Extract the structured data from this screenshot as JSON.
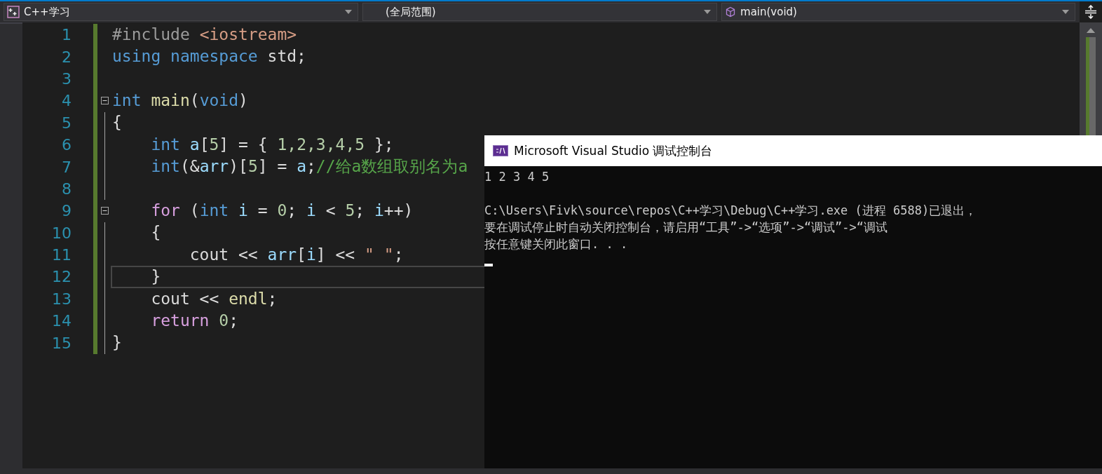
{
  "navigation_bar": {
    "dropdowns": [
      {
        "kind": "project",
        "label": "C++学习"
      },
      {
        "kind": "scope",
        "label": "(全局范围)"
      },
      {
        "kind": "member",
        "label": "main(void)"
      }
    ]
  },
  "editor": {
    "lines": [
      {
        "number": "1",
        "modified": true,
        "foldable": false,
        "current": false,
        "tokens": [
          {
            "text": "#include",
            "kind": "preprocessor"
          },
          {
            "text": " <iostream>",
            "kind": "string"
          }
        ]
      },
      {
        "number": "2",
        "modified": true,
        "foldable": false,
        "current": false,
        "tokens": [
          {
            "text": "using",
            "kind": "keyword"
          },
          {
            "text": " namespace",
            "kind": "keyword"
          },
          {
            "text": " std;",
            "kind": "plain"
          }
        ]
      },
      {
        "number": "3",
        "modified": true,
        "foldable": false,
        "current": false
      },
      {
        "number": "4",
        "modified": true,
        "foldable": true,
        "current": false,
        "tokens": [
          {
            "text": "int",
            "kind": "keyword"
          },
          {
            "text": " main",
            "kind": "function"
          },
          {
            "text": "(",
            "kind": "plain"
          },
          {
            "text": "void",
            "kind": "keyword"
          },
          {
            "text": ")",
            "kind": "plain"
          }
        ]
      },
      {
        "number": "5",
        "modified": true,
        "foldable": false,
        "current": false,
        "tokens": [
          {
            "text": "{",
            "kind": "plain"
          }
        ]
      },
      {
        "number": "6",
        "modified": true,
        "foldable": false,
        "current": false,
        "tokens": [
          {
            "text": "    int",
            "kind": "keyword"
          },
          {
            "text": " a",
            "kind": "variable"
          },
          {
            "text": "[",
            "kind": "plain"
          },
          {
            "text": "5",
            "kind": "number"
          },
          {
            "text": "] = { ",
            "kind": "plain"
          },
          {
            "text": "1,2,3,4,5",
            "kind": "number"
          },
          {
            "text": " };",
            "kind": "plain"
          }
        ]
      },
      {
        "number": "7",
        "modified": true,
        "foldable": false,
        "current": false,
        "tokens": [
          {
            "text": "    int",
            "kind": "keyword"
          },
          {
            "text": "(&",
            "kind": "plain"
          },
          {
            "text": "arr",
            "kind": "variable"
          },
          {
            "text": ")[",
            "kind": "plain"
          },
          {
            "text": "5",
            "kind": "number"
          },
          {
            "text": "] = ",
            "kind": "plain"
          },
          {
            "text": "a",
            "kind": "variable"
          },
          {
            "text": ";",
            "kind": "plain"
          },
          {
            "text": "//给a数组取别名为a",
            "kind": "comment"
          }
        ]
      },
      {
        "number": "8",
        "modified": true,
        "foldable": false,
        "current": false
      },
      {
        "number": "9",
        "modified": true,
        "foldable": true,
        "current": false,
        "tokens": [
          {
            "text": "    for",
            "kind": "control"
          },
          {
            "text": " (",
            "kind": "plain"
          },
          {
            "text": "int",
            "kind": "keyword"
          },
          {
            "text": " i",
            "kind": "variable"
          },
          {
            "text": " = ",
            "kind": "plain"
          },
          {
            "text": "0",
            "kind": "number"
          },
          {
            "text": "; ",
            "kind": "plain"
          },
          {
            "text": "i",
            "kind": "variable"
          },
          {
            "text": " < ",
            "kind": "plain"
          },
          {
            "text": "5",
            "kind": "number"
          },
          {
            "text": "; ",
            "kind": "plain"
          },
          {
            "text": "i",
            "kind": "variable"
          },
          {
            "text": "++)",
            "kind": "plain"
          }
        ]
      },
      {
        "number": "10",
        "modified": true,
        "foldable": false,
        "current": false,
        "tokens": [
          {
            "text": "    {",
            "kind": "plain"
          }
        ]
      },
      {
        "number": "11",
        "modified": true,
        "foldable": false,
        "current": false,
        "tokens": [
          {
            "text": "        cout << ",
            "kind": "plain"
          },
          {
            "text": "arr",
            "kind": "variable"
          },
          {
            "text": "[",
            "kind": "plain"
          },
          {
            "text": "i",
            "kind": "variable"
          },
          {
            "text": "] << ",
            "kind": "plain"
          },
          {
            "text": "\" \"",
            "kind": "string"
          },
          {
            "text": ";",
            "kind": "plain"
          }
        ]
      },
      {
        "number": "12",
        "modified": true,
        "foldable": false,
        "current": true,
        "tokens": [
          {
            "text": "    }",
            "kind": "plain"
          }
        ]
      },
      {
        "number": "13",
        "modified": true,
        "foldable": false,
        "current": false,
        "tokens": [
          {
            "text": "    cout << ",
            "kind": "plain"
          },
          {
            "text": "endl",
            "kind": "function"
          },
          {
            "text": ";",
            "kind": "plain"
          }
        ]
      },
      {
        "number": "14",
        "modified": true,
        "foldable": false,
        "current": false,
        "tokens": [
          {
            "text": "    return",
            "kind": "control"
          },
          {
            "text": " 0",
            "kind": "number"
          },
          {
            "text": ";",
            "kind": "plain"
          }
        ]
      },
      {
        "number": "15",
        "modified": true,
        "foldable": false,
        "current": false,
        "tokens": [
          {
            "text": "}",
            "kind": "plain"
          }
        ]
      }
    ]
  },
  "console_window": {
    "title": "Microsoft Visual Studio 调试控制台",
    "output": "1 2 3 4 5",
    "messages": [
      "C:\\Users\\Fivk\\source\\repos\\C++学习\\Debug\\C++学习.exe (进程 6588)已退出，",
      "要在调试停止时自动关闭控制台，请启用“工具”->“选项”->“调试”->“调试",
      "按任意键关闭此窗口. . ."
    ]
  }
}
